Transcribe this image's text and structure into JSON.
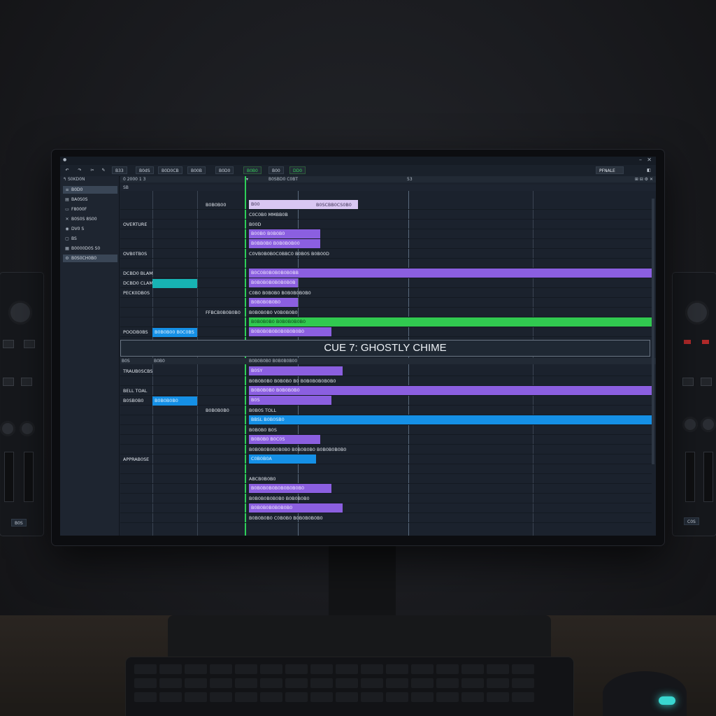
{
  "toolbar": {
    "buttons": [
      "B33",
      "B0dS",
      "B0D0CB",
      "B00B",
      "B0D0",
      "B0B0",
      "B00",
      "DD0"
    ],
    "final_label": "PFNALE"
  },
  "sidebar": {
    "header": "S0KD0N",
    "items": [
      "B0D0",
      "BA0S0S",
      "F8000F",
      "B0S0S 8S00",
      "DV0 S",
      "BS",
      "B0000D0S S0",
      "B0S0CH0B0"
    ]
  },
  "ruler": {
    "left_label": "0 2000 1 3",
    "timeline_label": "B0SBD0 C0BT",
    "marker": "53"
  },
  "tracks_upper": [
    {
      "name": "",
      "sub": "B0B0B00",
      "clip": "B00",
      "clip2": "B0SCBB0CS0B0",
      "color": "lilac"
    },
    {
      "name": "",
      "sub": "",
      "clip": "C0C0B0 MMBB0B",
      "color": "text"
    },
    {
      "name": "OVERTURE",
      "sub": "",
      "clip": "B00D",
      "color": "text"
    },
    {
      "name": "",
      "sub": "",
      "clip": "B00B0 B0B0B0",
      "color": "purple"
    },
    {
      "name": "",
      "sub": "",
      "clip": "B0BB0B0 B0B0B0B00",
      "color": "purple"
    },
    {
      "name": "OVB0TB0S",
      "sub": "",
      "clip": "C0VB0B0B0C0BBC0 B0B0S B0B00D",
      "color": "text"
    },
    {
      "name": "",
      "sub": "",
      "clip": "",
      "color": "none"
    },
    {
      "name": "DCBD0 BLAM",
      "sub": "",
      "clip": "B0C0B0B0B0B0B0BB",
      "color": "purple-long"
    },
    {
      "name": "DCBD0 CLAM",
      "sub": "teal",
      "clip": "B0B0B0B0B0B0B0B",
      "color": "purple"
    },
    {
      "name": "PECK0DB0S",
      "sub": "",
      "clip": "C0B0 B0B0B0 B0B0B0B0B0",
      "color": "text"
    },
    {
      "name": "",
      "sub": "",
      "clip": "B0B0B0B0B0",
      "color": "purple"
    },
    {
      "name": "",
      "sub": "FFBCB0B0B0B0",
      "clip": "B0B0B0B0 V0B0B0B0",
      "color": "text"
    },
    {
      "name": "",
      "sub": "",
      "clip": "B0B0B0B0 B0B0B0B0B0",
      "color": "green-long"
    },
    {
      "name": "POODB0BS",
      "sub": "B0B0B00 B0C0BS",
      "clip": "B0B0B0B0B0B0B0B0B0",
      "color": "purple"
    }
  ],
  "cue_title": "CUE 7: GHOSTLY CHIME",
  "lower_ruler": {
    "left": "B0S",
    "left2": "B0B0",
    "mid": "B0B0B0B0 B0B0B0B00"
  },
  "tracks_lower": [
    {
      "name": "TRAUB0SCBS",
      "sub": "",
      "clip": "B0SY",
      "color": "purple"
    },
    {
      "name": "",
      "sub": "",
      "clip": "B0B0B0B0 B0B0B0 B0 B0B0B0B0B0B0",
      "color": "text"
    },
    {
      "name": "BELL TOAL",
      "sub": "",
      "clip": "B0B0B0B0 B0B0B0B0",
      "color": "purple-long"
    },
    {
      "name": "B0SB0B0",
      "sub": "B0B0B0B0",
      "clip": "B0S",
      "color": "purple"
    },
    {
      "name": "",
      "sub": "B0B0B0B0",
      "clip": "B0B0S TOLL",
      "color": "text"
    },
    {
      "name": "",
      "sub": "",
      "clip": "BBSL B0B0SB0",
      "color": "blue-long"
    },
    {
      "name": "",
      "sub": "",
      "clip": "B0B0B0 B0S",
      "color": "text"
    },
    {
      "name": "",
      "sub": "",
      "clip": "B0B0B0 B0C0S",
      "color": "purple"
    },
    {
      "name": "",
      "sub": "",
      "clip": "B0B0B0B0B0B0B0 B0B0B0B0 B0B0B0B0B0",
      "color": "text"
    },
    {
      "name": "APPRAB0SE",
      "sub": "",
      "clip": "C0B0B0A",
      "color": "blue"
    },
    {
      "name": "",
      "sub": "",
      "clip": "",
      "color": "none"
    },
    {
      "name": "",
      "sub": "",
      "clip": "ABCB0B0B0",
      "color": "text"
    },
    {
      "name": "",
      "sub": "",
      "clip": "B0B0B0B0B0B0B0B0B0",
      "color": "purple"
    },
    {
      "name": "",
      "sub": "",
      "clip": "B0B0B0B0B0B0 B0B0B0B0",
      "color": "text"
    },
    {
      "name": "",
      "sub": "",
      "clip": "B0B0B0B0B0B0B0",
      "color": "purple"
    },
    {
      "name": "",
      "sub": "",
      "clip": "B0B0B0B0 C0B0B0 B0B0B0B0B0",
      "color": "text"
    }
  ],
  "side_device": {
    "left_label": "B0S",
    "right_label": "C0S"
  }
}
